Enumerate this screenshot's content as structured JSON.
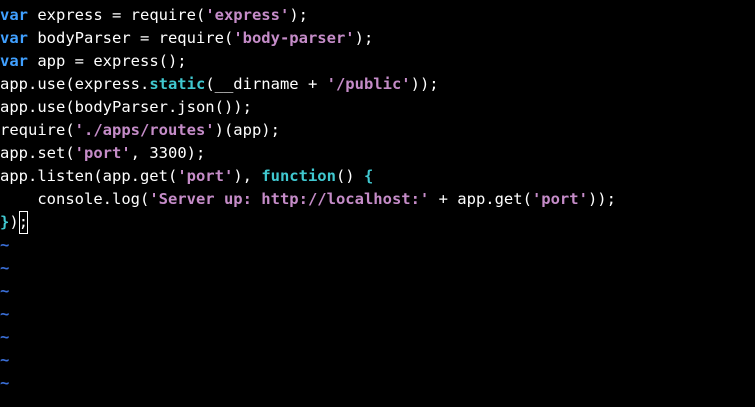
{
  "editor": {
    "lines": [
      {
        "parts": [
          {
            "t": "var",
            "c": "kw"
          },
          {
            "t": " express = require(",
            "c": "plain"
          },
          {
            "t": "'express'",
            "c": "str"
          },
          {
            "t": ");",
            "c": "plain"
          }
        ]
      },
      {
        "parts": [
          {
            "t": "var",
            "c": "kw"
          },
          {
            "t": " bodyParser = require(",
            "c": "plain"
          },
          {
            "t": "'body-parser'",
            "c": "str"
          },
          {
            "t": ");",
            "c": "plain"
          }
        ]
      },
      {
        "parts": [
          {
            "t": "var",
            "c": "kw"
          },
          {
            "t": " app = express();",
            "c": "plain"
          }
        ]
      },
      {
        "parts": [
          {
            "t": "app.use(express.",
            "c": "plain"
          },
          {
            "t": "static",
            "c": "fn"
          },
          {
            "t": "(__dirname + ",
            "c": "plain"
          },
          {
            "t": "'/public'",
            "c": "str"
          },
          {
            "t": "));",
            "c": "plain"
          }
        ]
      },
      {
        "parts": [
          {
            "t": "app.use(bodyParser.json());",
            "c": "plain"
          }
        ]
      },
      {
        "parts": [
          {
            "t": "require(",
            "c": "plain"
          },
          {
            "t": "'./apps/routes'",
            "c": "str"
          },
          {
            "t": ")(app);",
            "c": "plain"
          }
        ]
      },
      {
        "parts": [
          {
            "t": "app.set(",
            "c": "plain"
          },
          {
            "t": "'port'",
            "c": "str"
          },
          {
            "t": ", 3300);",
            "c": "plain"
          }
        ]
      },
      {
        "parts": [
          {
            "t": "app.listen(app.get(",
            "c": "plain"
          },
          {
            "t": "'port'",
            "c": "str"
          },
          {
            "t": "), ",
            "c": "plain"
          },
          {
            "t": "function",
            "c": "fn"
          },
          {
            "t": "() ",
            "c": "plain"
          },
          {
            "t": "{",
            "c": "fn"
          }
        ]
      },
      {
        "parts": [
          {
            "t": "    console.log(",
            "c": "plain"
          },
          {
            "t": "'Server up: http://localhost:'",
            "c": "str"
          },
          {
            "t": " + app.get(",
            "c": "plain"
          },
          {
            "t": "'port'",
            "c": "str"
          },
          {
            "t": "));",
            "c": "plain"
          }
        ]
      },
      {
        "parts": [
          {
            "t": "}",
            "c": "fn"
          },
          {
            "t": ")",
            "c": "plain"
          },
          {
            "t": ";",
            "c": "cursor"
          }
        ]
      }
    ],
    "empty_line_marker": "~",
    "empty_line_count": 7,
    "colors": {
      "background": "#000000",
      "keyword": "#40a0ff",
      "function": "#40c8d0",
      "string": "#c58cc8",
      "text": "#ffffff",
      "tilde": "#3a6fd8"
    }
  }
}
